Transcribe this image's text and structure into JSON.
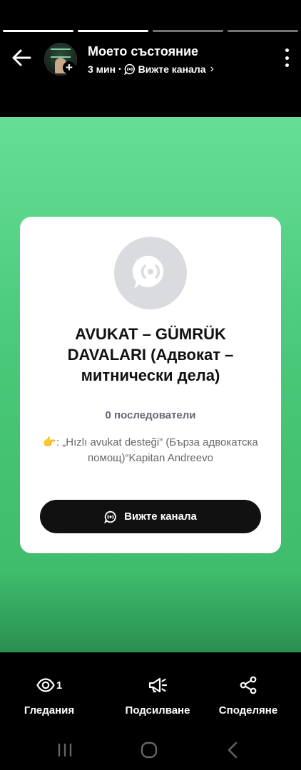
{
  "status_progress": {
    "segments": 4,
    "completed": 2
  },
  "header": {
    "title": "Моето състояние",
    "time": "3 мин",
    "separator": "•",
    "view_channel_link": "Вижте канала"
  },
  "channel_card": {
    "title": "AVUKAT – GÜMRÜK DAVALARI (Адвокат – митнически дела)",
    "followers": "0 последователи",
    "description": "👉: „Hızlı avukat desteği” (Бърза адвокатска помощ)“Kapitan Andreevo",
    "button_label": "Вижте канала"
  },
  "actions": {
    "views_count": "1",
    "views_label": "Гледания",
    "boost_label": "Подсилване",
    "share_label": "Споделяне"
  },
  "colors": {
    "story_top": "#66de96",
    "story_bottom": "#2a8f50",
    "card_bg": "#ffffff",
    "button_bg": "#111111"
  },
  "icons": [
    "back-arrow-icon",
    "channel-icon",
    "chevron-right-icon",
    "more-vert-icon",
    "eye-icon",
    "megaphone-icon",
    "share-icon",
    "recents-icon",
    "home-icon",
    "back-nav-icon"
  ]
}
